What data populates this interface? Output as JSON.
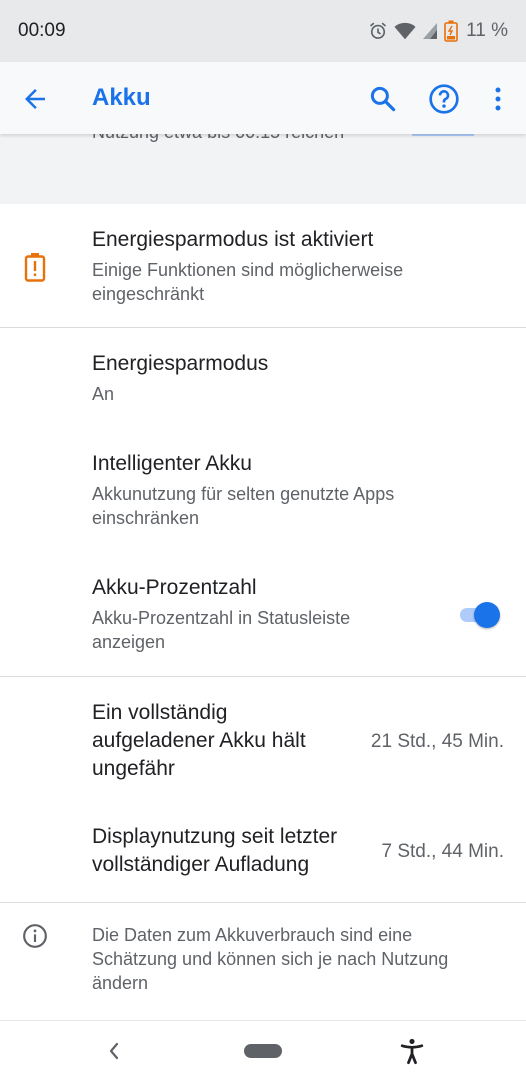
{
  "status_bar": {
    "time": "00:09",
    "battery_percent": "11 %"
  },
  "app_bar": {
    "title": "Akku"
  },
  "scrolled_text": "Nutzung etwa bis 00:15 reichen",
  "battery_saver_banner": {
    "title": "Energiesparmodus ist aktiviert",
    "subtitle": "Einige Funktionen sind möglicherweise eingeschränkt"
  },
  "settings": [
    {
      "title": "Energiesparmodus",
      "subtitle": "An"
    },
    {
      "title": "Intelligenter Akku",
      "subtitle": "Akkunutzung für selten genutzte Apps einschränken"
    },
    {
      "title": "Akku-Prozentzahl",
      "subtitle": "Akku-Prozentzahl in Statusleiste anzeigen",
      "toggle_on": true
    }
  ],
  "stats": [
    {
      "label": "Ein vollständig aufgeladener Akku hält ungefähr",
      "value": "21 Std., 45 Min."
    },
    {
      "label": "Displaynutzung seit letzter vollständiger Aufladung",
      "value": "7 Std., 44 Min."
    }
  ],
  "info_note": "Die Daten zum Akkuverbrauch sind eine Schätzung und können sich je nach Nutzung ändern",
  "colors": {
    "accent": "#1a73e8",
    "warning": "#e8710a",
    "text_primary": "#202124",
    "text_secondary": "#5f6368"
  },
  "icons": [
    "alarm-icon",
    "wifi-icon",
    "cell-signal-icon",
    "battery-low-icon",
    "back-arrow-icon",
    "search-icon",
    "help-icon",
    "more-vert-icon",
    "battery-alert-icon",
    "info-icon",
    "nav-back-icon",
    "nav-home-pill",
    "accessibility-icon"
  ]
}
